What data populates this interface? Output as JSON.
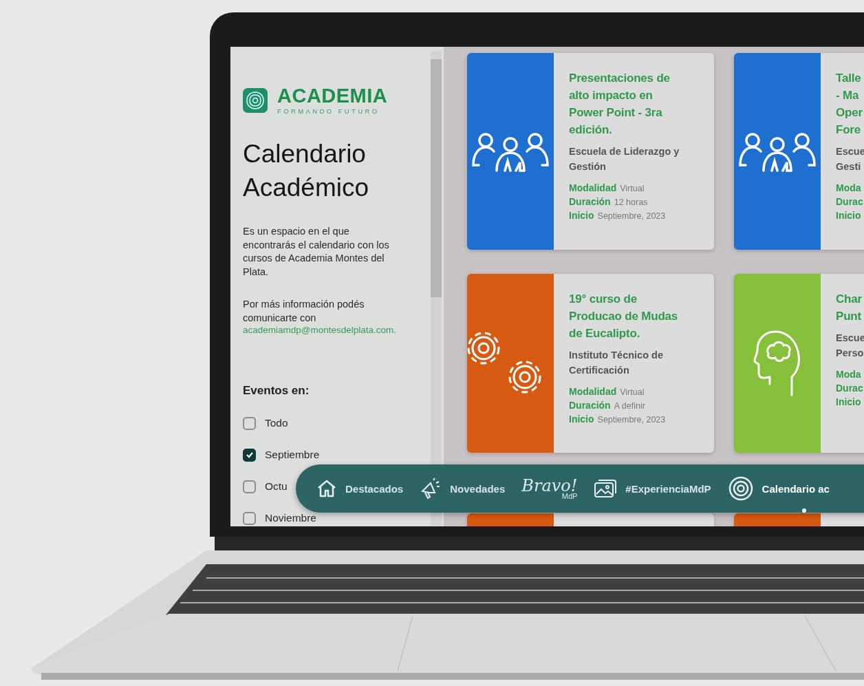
{
  "sidebar": {
    "logo": {
      "name": "ACADEMIA",
      "tagline": "FORMANDO FUTURO"
    },
    "title": "Calendario Académico",
    "description": "Es un espacio en el que encontrarás el calendario con los cursos de Academia Montes del Plata.",
    "contact_text": "Por más información podés comunicarte con",
    "contact_email": "academiamdp@montesdelplata.com.",
    "filter_heading": "Eventos en:",
    "filters": [
      {
        "label": "Todo",
        "checked": false
      },
      {
        "label": "Septiembre",
        "checked": true
      },
      {
        "label": "Octu",
        "checked": false
      },
      {
        "label": "Noviembre",
        "checked": false
      }
    ]
  },
  "cards": [
    {
      "kind": "people",
      "color": "#1f6fd0",
      "title_lines": [
        "Presentaciones de",
        "alto impacto en",
        "Power Point - 3ra",
        "edición."
      ],
      "school_lines": [
        "Escuela de Liderazgo y",
        "Gestión"
      ],
      "meta": [
        {
          "label": "Modalidad",
          "value": "Virtual"
        },
        {
          "label": "Duración",
          "value": "12 horas"
        },
        {
          "label": "Inicio",
          "value": "Septiembre, 2023"
        }
      ]
    },
    {
      "kind": "people",
      "color": "#1f6fd0",
      "title_lines": [
        "Talle",
        "- Ma",
        "Oper",
        "Fore"
      ],
      "school_lines": [
        "Escue",
        "Gesti"
      ],
      "meta": [
        {
          "label": "Moda"
        },
        {
          "label": "Durac"
        },
        {
          "label": "Inicio"
        }
      ]
    },
    {
      "kind": "gears",
      "color": "#d65a12",
      "title_lines": [
        "19° curso de",
        "Producao de Mudas",
        "de Eucalipto."
      ],
      "school_lines": [
        "Instituto Técnico de",
        "Certificación"
      ],
      "meta": [
        {
          "label": "Modalidad",
          "value": "Virtual"
        },
        {
          "label": "Duración",
          "value": "A definir"
        },
        {
          "label": "Inicio",
          "value": "Septiembre, 2023"
        }
      ]
    },
    {
      "kind": "head",
      "color": "#86bf3a",
      "title_lines": [
        "Char",
        "Punt"
      ],
      "school_lines": [
        "Escue",
        "Perso"
      ],
      "meta": [
        {
          "label": "Moda"
        },
        {
          "label": "Durac"
        },
        {
          "label": "Inicio"
        }
      ]
    }
  ],
  "peek_cards": [
    {
      "color": "#d65a12"
    },
    {
      "color": "#d65a12"
    }
  ],
  "nav": [
    {
      "kind": "home",
      "label": "Destacados",
      "selected": false
    },
    {
      "kind": "megaphone",
      "label": "Novedades",
      "selected": false
    },
    {
      "kind": "logo",
      "label": "Bravo!",
      "sub": "MdP",
      "selected": false
    },
    {
      "kind": "photos",
      "label": "#ExperienciaMdP",
      "selected": false
    },
    {
      "kind": "rings",
      "label": "Calendario ac",
      "selected": true
    }
  ]
}
